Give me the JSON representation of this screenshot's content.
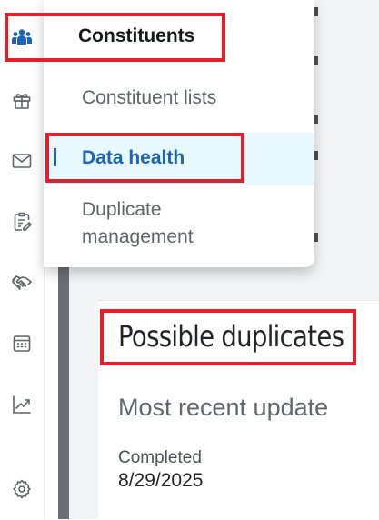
{
  "rail": {
    "items": [
      {
        "name": "constituents-icon"
      },
      {
        "name": "gift-icon"
      },
      {
        "name": "mail-icon"
      },
      {
        "name": "clipboard-edit-icon"
      },
      {
        "name": "handshake-icon"
      },
      {
        "name": "calendar-icon"
      },
      {
        "name": "analytics-icon"
      },
      {
        "name": "gear-icon"
      }
    ]
  },
  "flyout": {
    "header": "Constituents",
    "items": [
      {
        "label": "Constituent lists"
      },
      {
        "label": "Data health",
        "active": true
      },
      {
        "label": "Duplicate management"
      }
    ]
  },
  "card": {
    "title": "Possible duplicates",
    "subtitle": "Most recent update",
    "status_label": "Completed",
    "status_date": "8/29/2025"
  },
  "colors": {
    "accent": "#1e64b4",
    "active_bg": "#e8f8ff",
    "highlight": "#e0202b"
  }
}
